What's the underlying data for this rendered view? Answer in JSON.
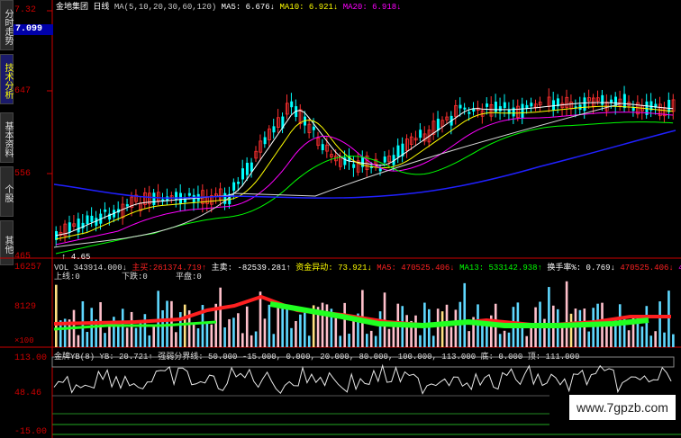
{
  "side_tabs": [
    {
      "label": "分时走势",
      "active": false
    },
    {
      "label": "技术分析",
      "active": true
    },
    {
      "label": "基本资料",
      "active": false
    },
    {
      "label": "个股",
      "active": false
    },
    {
      "label": "其他",
      "active": false
    }
  ],
  "price_panel": {
    "stock_name": "金地集团",
    "period": "日线",
    "ma_params": "MA(5,10,20,30,60,120)",
    "ma5": "MA5: 6.676↓",
    "ma10": "MA10: 6.921↓",
    "ma20": "MA20: 6.918↓",
    "current_price": "7.099",
    "y_labels": [
      "7.32",
      "647",
      "556",
      "465"
    ],
    "low_marker": "4.65",
    "colors": {
      "ma5": "#ffffff",
      "ma10": "#ffff00",
      "ma20": "#ff00ff",
      "ma30": "#00ff00",
      "ma60": "#d8d8d8",
      "ma120": "#2020ff",
      "up": "#ff3030",
      "down": "#00ffff"
    }
  },
  "volume_panel": {
    "vol": "VOL 343914.000↓",
    "item_a_label": "主买:",
    "item_a_value": "261374.719↑",
    "item_b": "主卖: -82539.281↑",
    "item_c": "资金异动: 73.921↓",
    "item_d": "MA5: 470525.406↓",
    "item_e": "MA13: 533142.938↑",
    "item_f": "换手率%: 0.769↓",
    "item_g": "470525.406↓",
    "item_h": "470525",
    "up_line": "上线:0",
    "down_line": "下跌:0",
    "flat_line": "平盘:0",
    "y_labels": [
      "16257",
      "8129",
      "×100"
    ]
  },
  "indicator_panel": {
    "name": "金牌YB(8)",
    "yb": "YB: 20.721↑",
    "boundary": "强弱分界线: 50.000",
    "values": "-15.000, 0.000, 20.000, 80.000, 100.000, 113.000",
    "bottom_label": "底: 0.000",
    "top_label": "顶: 111.000",
    "y_labels": [
      "113.00",
      "48.46",
      "-15.00"
    ]
  },
  "watermark": "www.7gpzb.com"
}
